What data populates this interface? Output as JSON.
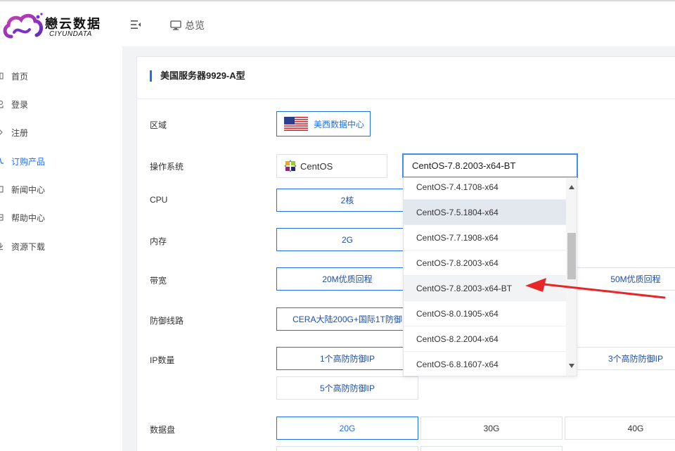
{
  "brand": {
    "name_cn": "戀云数据",
    "name_en": "CIYUNDATA",
    "cloud_icon": "cloud-logo-icon"
  },
  "header": {
    "menu_icon": "menu-fold-icon",
    "overview_icon": "monitor-icon",
    "overview_label": "总览"
  },
  "sidebar": {
    "items": [
      {
        "label": "首页",
        "icon": "home-icon",
        "active": false
      },
      {
        "label": "登录",
        "icon": "login-icon",
        "active": false
      },
      {
        "label": "注册",
        "icon": "register-icon",
        "active": false
      },
      {
        "label": "订购产品",
        "icon": "cart-icon",
        "active": true
      },
      {
        "label": "新闻中心",
        "icon": "news-icon",
        "active": false
      },
      {
        "label": "帮助中心",
        "icon": "help-icon",
        "active": false
      },
      {
        "label": "资源下载",
        "icon": "download-icon",
        "active": false
      }
    ]
  },
  "product": {
    "title": "美国服务器9929-A型",
    "region": {
      "label": "区域",
      "option": "美西数据中心",
      "flag_icon": "us-flag-icon"
    },
    "os": {
      "label": "操作系统",
      "family": "CentOS",
      "family_icon": "centos-logo-icon",
      "selected": "CentOS-7.8.2003-x64-BT",
      "options": [
        "CentOS-7.4.1708-x64",
        "CentOS-7.5.1804-x64",
        "CentOS-7.7.1908-x64",
        "CentOS-7.8.2003-x64",
        "CentOS-7.8.2003-x64-BT",
        "CentOS-8.0.1905-x64",
        "CentOS-8.2.2004-x64",
        "CentOS-6.8.1607-x64"
      ],
      "hover_option": "CentOS-7.5.1804-x64"
    },
    "cpu": {
      "label": "CPU",
      "options": [
        "2核"
      ]
    },
    "memory": {
      "label": "内存",
      "options": [
        "2G"
      ]
    },
    "bandwidth": {
      "label": "带宽",
      "options": [
        "20M优质回程",
        "50M优质回程"
      ]
    },
    "defense_line": {
      "label": "防御线路",
      "options": [
        "CERA大陆200G+国际1T防御"
      ]
    },
    "ip_count": {
      "label": "IP数量",
      "options": [
        "1个高防防御IP",
        "3个高防防御IP",
        "5个高防防御IP"
      ]
    },
    "data_disk": {
      "label": "数据盘",
      "options": [
        "20G",
        "30G",
        "40G"
      ]
    }
  },
  "colors": {
    "accent": "#1e6ff2",
    "arrow": "#e8262a",
    "hover": "#e3e7ee"
  }
}
